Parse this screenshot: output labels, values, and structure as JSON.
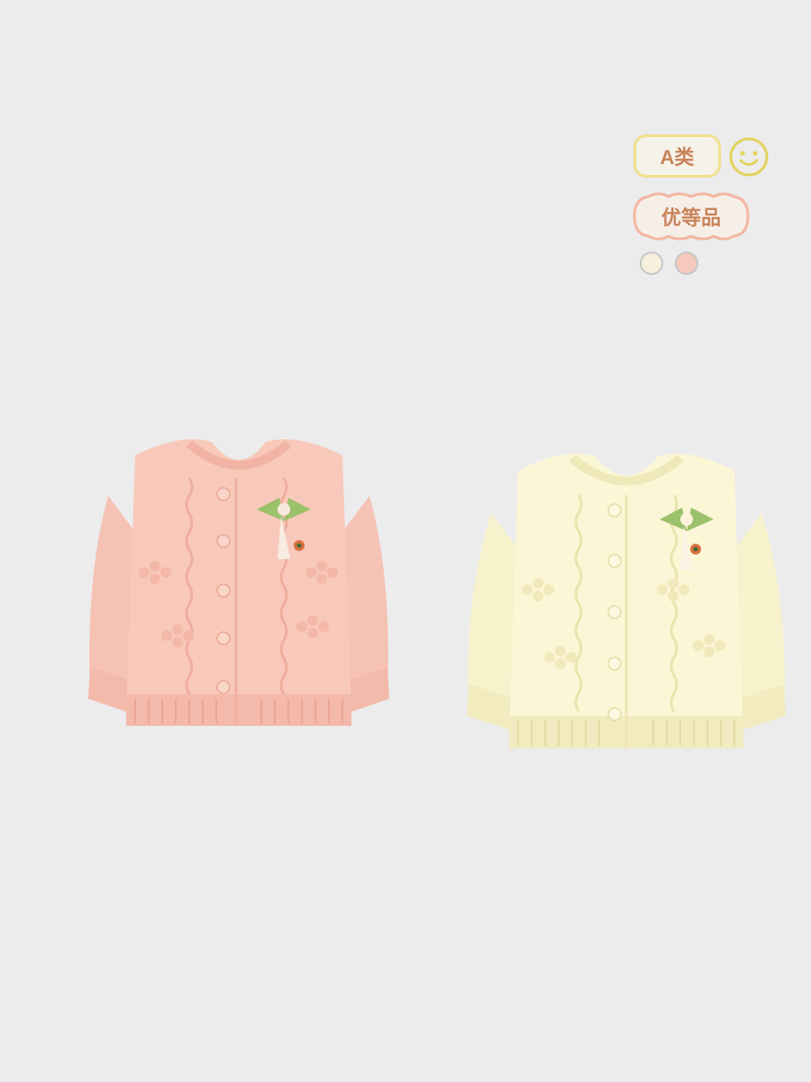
{
  "badges": {
    "class_label": "A类",
    "grade_label": "优等品"
  },
  "icons": {
    "smiley": "smiley-face-icon"
  },
  "colors": {
    "background": "#ececec",
    "badge_text": "#c9835a",
    "badge_a_border": "#f0e08c",
    "badge_grade_border": "#f4b6a3",
    "smiley": "#e3d25c"
  },
  "color_options": [
    {
      "name": "cream",
      "hex": "#f6f0dc"
    },
    {
      "name": "pink",
      "hex": "#f5c9bc"
    }
  ],
  "products": [
    {
      "color": "pink",
      "hex": "#f8c9bb"
    },
    {
      "color": "cream",
      "hex": "#fbf6d6"
    }
  ]
}
